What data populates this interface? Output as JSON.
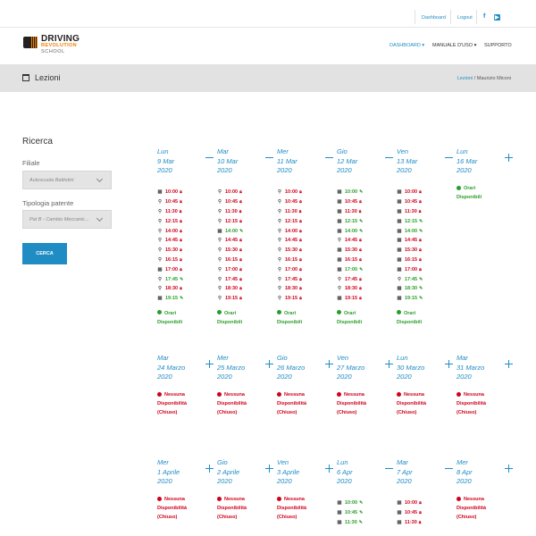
{
  "header": {
    "links": [
      "Dashboard",
      "Logout"
    ],
    "social": [
      "facebook-icon",
      "youtube-icon"
    ],
    "logo": {
      "line1": "DRIVING",
      "line2": "REVOLUTION",
      "line3": "SCHOOL"
    },
    "nav": [
      {
        "label": "DASHBOARD ▾"
      },
      {
        "label": "MANUALE D'USO ▾"
      },
      {
        "label": "SUPPORTO"
      }
    ]
  },
  "title_bar": {
    "title": "Lezioni",
    "breadcrumb": [
      "Lezioni",
      "Maurizio Miconi"
    ]
  },
  "search": {
    "heading": "Ricerca",
    "filiale_label": "Filiale",
    "filiale_value": "Autoscuola Battistini",
    "patente_label": "Tipologia patente",
    "patente_value": "Pat B - Cambio Meccanic...",
    "button": "CERCA"
  },
  "week1": [
    {
      "weekday": "Lun",
      "date": "9 Mar",
      "year": "2020",
      "control": "minus",
      "slots": [
        [
          "10:00",
          "busy",
          "calendar"
        ],
        [
          "10:45",
          "busy",
          "search"
        ],
        [
          "11:30",
          "busy",
          "search"
        ],
        [
          "12:15",
          "busy",
          "search"
        ],
        [
          "14:00",
          "busy",
          "search"
        ],
        [
          "14:45",
          "busy",
          "search"
        ],
        [
          "15:30",
          "busy",
          "search"
        ],
        [
          "16:15",
          "busy",
          "search"
        ],
        [
          "17:00",
          "busy",
          "calendar"
        ],
        [
          "17:45",
          "free",
          "search"
        ],
        [
          "18:30",
          "busy",
          "search"
        ],
        [
          "19:15",
          "free",
          "calendar"
        ]
      ],
      "status": [
        "Orari",
        "Disponibili"
      ],
      "status_type": "ok"
    },
    {
      "weekday": "Mar",
      "date": "10 Mar",
      "year": "2020",
      "control": "minus",
      "slots": [
        [
          "10:00",
          "busy",
          "search"
        ],
        [
          "10:45",
          "busy",
          "search"
        ],
        [
          "11:30",
          "busy",
          "search"
        ],
        [
          "12:15",
          "busy",
          "search"
        ],
        [
          "14:00",
          "free",
          "calendar"
        ],
        [
          "14:45",
          "busy",
          "search"
        ],
        [
          "15:30",
          "busy",
          "search"
        ],
        [
          "16:15",
          "busy",
          "search"
        ],
        [
          "17:00",
          "busy",
          "search"
        ],
        [
          "17:45",
          "busy",
          "search"
        ],
        [
          "18:30",
          "busy",
          "search"
        ],
        [
          "19:15",
          "busy",
          "search"
        ]
      ],
      "status": [
        "Orari",
        "Disponibili"
      ],
      "status_type": "ok"
    },
    {
      "weekday": "Mer",
      "date": "11 Mar",
      "year": "2020",
      "control": "minus",
      "slots": [
        [
          "10:00",
          "busy",
          "search"
        ],
        [
          "10:45",
          "busy",
          "search"
        ],
        [
          "11:30",
          "busy",
          "search"
        ],
        [
          "12:15",
          "busy",
          "search"
        ],
        [
          "14:00",
          "busy",
          "search"
        ],
        [
          "14:45",
          "busy",
          "search"
        ],
        [
          "15:30",
          "busy",
          "search"
        ],
        [
          "16:15",
          "busy",
          "search"
        ],
        [
          "17:00",
          "busy",
          "search"
        ],
        [
          "17:45",
          "busy",
          "search"
        ],
        [
          "18:30",
          "busy",
          "search"
        ],
        [
          "19:15",
          "busy",
          "search"
        ]
      ],
      "status": [
        "Orari",
        "Disponibili"
      ],
      "status_type": "ok"
    },
    {
      "weekday": "Gio",
      "date": "12 Mar",
      "year": "2020",
      "control": "minus",
      "slots": [
        [
          "10:00",
          "free",
          "calendar"
        ],
        [
          "10:45",
          "busy",
          "calendar"
        ],
        [
          "11:30",
          "busy",
          "calendar"
        ],
        [
          "12:15",
          "free",
          "calendar"
        ],
        [
          "14:00",
          "free",
          "calendar"
        ],
        [
          "14:45",
          "busy",
          "search"
        ],
        [
          "15:30",
          "busy",
          "calendar"
        ],
        [
          "16:15",
          "busy",
          "calendar"
        ],
        [
          "17:00",
          "free",
          "calendar"
        ],
        [
          "17:45",
          "busy",
          "search"
        ],
        [
          "18:30",
          "busy",
          "search"
        ],
        [
          "19:15",
          "busy",
          "calendar"
        ]
      ],
      "status": [
        "Orari",
        "Disponibili"
      ],
      "status_type": "ok"
    },
    {
      "weekday": "Ven",
      "date": "13 Mar",
      "year": "2020",
      "control": "minus",
      "slots": [
        [
          "10:00",
          "busy",
          "calendar"
        ],
        [
          "10:45",
          "busy",
          "calendar"
        ],
        [
          "11:30",
          "busy",
          "calendar"
        ],
        [
          "12:15",
          "free",
          "calendar"
        ],
        [
          "14:00",
          "free",
          "calendar"
        ],
        [
          "14:45",
          "busy",
          "calendar"
        ],
        [
          "15:30",
          "busy",
          "calendar"
        ],
        [
          "16:15",
          "busy",
          "calendar"
        ],
        [
          "17:00",
          "busy",
          "calendar"
        ],
        [
          "17:45",
          "free",
          "search"
        ],
        [
          "18:30",
          "free",
          "calendar"
        ],
        [
          "19:15",
          "free",
          "calendar"
        ]
      ],
      "status": [
        "Orari",
        "Disponibili"
      ],
      "status_type": "ok"
    },
    {
      "weekday": "Lun",
      "date": "16 Mar",
      "year": "2020",
      "control": "plus",
      "slots": [],
      "status": [
        "Orari",
        "Disponibili"
      ],
      "status_type": "ok"
    }
  ],
  "week2": [
    {
      "weekday": "Mar",
      "date": "24 Marzo",
      "year": "2020",
      "control": "plus",
      "slots": [],
      "status": [
        "Nessuna",
        "Disponibilità",
        "(Chiuso)"
      ],
      "status_type": "no"
    },
    {
      "weekday": "Mer",
      "date": "25 Marzo",
      "year": "2020",
      "control": "plus",
      "slots": [],
      "status": [
        "Nessuna",
        "Disponibilità",
        "(Chiuso)"
      ],
      "status_type": "no"
    },
    {
      "weekday": "Gio",
      "date": "26 Marzo",
      "year": "2020",
      "control": "plus",
      "slots": [],
      "status": [
        "Nessuna",
        "Disponibilità",
        "(Chiuso)"
      ],
      "status_type": "no"
    },
    {
      "weekday": "Ven",
      "date": "27 Marzo",
      "year": "2020",
      "control": "plus",
      "slots": [],
      "status": [
        "Nessuna",
        "Disponibilità",
        "(Chiuso)"
      ],
      "status_type": "no"
    },
    {
      "weekday": "Lun",
      "date": "30 Marzo",
      "year": "2020",
      "control": "plus",
      "slots": [],
      "status": [
        "Nessuna",
        "Disponibilità",
        "(Chiuso)"
      ],
      "status_type": "no"
    },
    {
      "weekday": "Mar",
      "date": "31 Marzo",
      "year": "2020",
      "control": "plus",
      "slots": [],
      "status": [
        "Nessuna",
        "Disponibilità",
        "(Chiuso)"
      ],
      "status_type": "no"
    }
  ],
  "week3": [
    {
      "weekday": "Mer",
      "date": "1 Aprile",
      "year": "2020",
      "control": "plus",
      "slots": [],
      "status": [
        "Nessuna",
        "Disponibilità",
        "(Chiuso)"
      ],
      "status_type": "no"
    },
    {
      "weekday": "Gio",
      "date": "2 Aprile",
      "year": "2020",
      "control": "plus",
      "slots": [],
      "status": [
        "Nessuna",
        "Disponibilità",
        "(Chiuso)"
      ],
      "status_type": "no"
    },
    {
      "weekday": "Ven",
      "date": "3 Aprile",
      "year": "2020",
      "control": "plus",
      "slots": [],
      "status": [
        "Nessuna",
        "Disponibilità",
        "(Chiuso)"
      ],
      "status_type": "no"
    },
    {
      "weekday": "Lun",
      "date": "6 Apr",
      "year": "2020",
      "control": "minus",
      "slots": [
        [
          "10:00",
          "free",
          "calendar"
        ],
        [
          "10:45",
          "free",
          "calendar"
        ],
        [
          "11:30",
          "free",
          "calendar"
        ]
      ],
      "status": [],
      "status_type": "ok"
    },
    {
      "weekday": "Mar",
      "date": "7 Apr",
      "year": "2020",
      "control": "minus",
      "slots": [
        [
          "10:00",
          "busy",
          "calendar"
        ],
        [
          "10:45",
          "busy",
          "calendar"
        ],
        [
          "11:30",
          "busy",
          "calendar"
        ]
      ],
      "status": [],
      "status_type": "ok"
    },
    {
      "weekday": "Mer",
      "date": "8 Apr",
      "year": "2020",
      "control": "plus",
      "slots": [],
      "status": [
        "Nessuna",
        "Disponibilità",
        "(Chiuso)"
      ],
      "status_type": "no"
    }
  ]
}
